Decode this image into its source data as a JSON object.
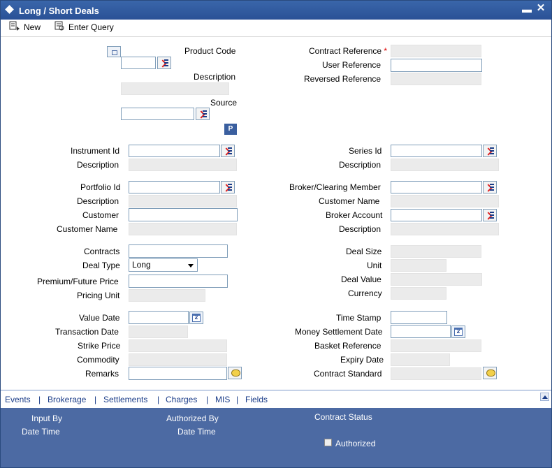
{
  "window": {
    "title": "Long / Short Deals"
  },
  "toolbar": {
    "new_label": "New",
    "enter_query_label": "Enter Query"
  },
  "header": {
    "product_code_label": "Product Code",
    "description_label": "Description",
    "source_label": "Source",
    "p_button_label": "P",
    "contract_reference_label": "Contract Reference",
    "required_mark": "*",
    "user_reference_label": "User Reference",
    "reversed_reference_label": "Reversed Reference"
  },
  "form": {
    "instrument_id_label": "Instrument Id",
    "instrument_description_label": "Description",
    "series_id_label": "Series Id",
    "series_description_label": "Description",
    "portfolio_id_label": "Portfolio Id",
    "portfolio_description_label": "Description",
    "customer_label": "Customer",
    "customer_name_label": "Customer Name",
    "broker_label": "Broker/Clearing Member",
    "broker_customer_name_label": "Customer Name",
    "broker_account_label": "Broker Account",
    "broker_description_label": "Description",
    "contracts_label": "Contracts",
    "deal_type_label": "Deal Type",
    "deal_type_value": "Long",
    "premium_label": "Premium/Future Price",
    "pricing_unit_label": "Pricing Unit",
    "deal_size_label": "Deal Size",
    "unit_label": "Unit",
    "deal_value_label": "Deal Value",
    "currency_label": "Currency",
    "value_date_label": "Value Date",
    "transaction_date_label": "Transaction Date",
    "strike_price_label": "Strike Price",
    "commodity_label": "Commodity",
    "remarks_label": "Remarks",
    "time_stamp_label": "Time Stamp",
    "money_settlement_label": "Money Settlement Date",
    "basket_reference_label": "Basket Reference",
    "expiry_date_label": "Expiry Date",
    "contract_standard_label": "Contract Standard"
  },
  "footer_links": [
    "Events",
    "Brokerage",
    "Settlements",
    "Charges",
    "MIS",
    "Fields"
  ],
  "footer_sep": "|",
  "audit": {
    "input_by": "Input By",
    "date_time_1": "Date Time",
    "authorized_by": "Authorized By",
    "date_time_2": "Date Time",
    "contract_status": "Contract Status",
    "authorized": "Authorized"
  }
}
